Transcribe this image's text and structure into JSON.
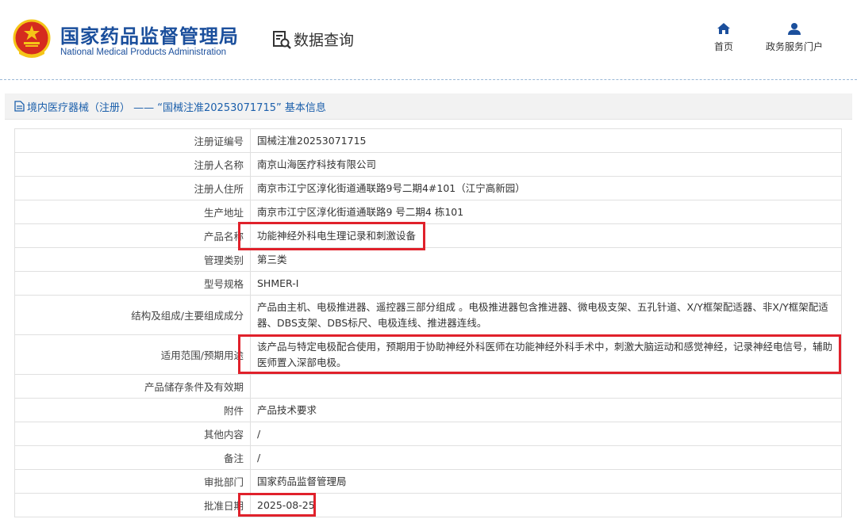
{
  "header": {
    "org_name_cn": "国家药品监督管理局",
    "org_name_en": "National Medical Products Administration",
    "data_query_label": "数据查询",
    "nav": [
      {
        "icon": "home-icon",
        "label": "首页"
      },
      {
        "icon": "user-icon",
        "label": "政务服务门户"
      }
    ]
  },
  "section": {
    "title": "境内医疗器械（注册） —— “国械注准20253071715” 基本信息"
  },
  "record": {
    "rows": [
      {
        "label": "注册证编号",
        "value": "国械注准20253071715"
      },
      {
        "label": "注册人名称",
        "value": "南京山海医疗科技有限公司"
      },
      {
        "label": "注册人住所",
        "value": "南京市江宁区淳化街道通联路9号二期4#101（江宁高新园）"
      },
      {
        "label": "生产地址",
        "value": "南京市江宁区淳化街道通联路9 号二期4 栋101"
      },
      {
        "label": "产品名称",
        "value": "功能神经外科电生理记录和刺激设备"
      },
      {
        "label": "管理类别",
        "value": "第三类"
      },
      {
        "label": "型号规格",
        "value": "SHMER-I"
      },
      {
        "label": "结构及组成/主要组成成分",
        "value": "产品由主机、电极推进器、遥控器三部分组成 。电极推进器包含推进器、微电极支架、五孔针道、X/Y框架配适器、非X/Y框架配适器、DBS支架、DBS标尺、电极连线、推进器连线。"
      },
      {
        "label": "适用范围/预期用途",
        "value": "该产品与特定电极配合使用，预期用于协助神经外科医师在功能神经外科手术中，刺激大脑运动和感觉神经，记录神经电信号，辅助医师置入深部电极。"
      },
      {
        "label": "产品储存条件及有效期",
        "value": ""
      },
      {
        "label": "附件",
        "value": "产品技术要求"
      },
      {
        "label": "其他内容",
        "value": "/"
      },
      {
        "label": "备注",
        "value": "/"
      },
      {
        "label": "审批部门",
        "value": "国家药品监督管理局"
      },
      {
        "label": "批准日期",
        "value": "2025-08-25"
      }
    ]
  },
  "colors": {
    "brand_blue": "#1b4f9c",
    "link_blue": "#1b5fab",
    "highlight_red": "#e0212b",
    "emblem_red": "#d52b1e",
    "emblem_gold": "#f5c518"
  }
}
